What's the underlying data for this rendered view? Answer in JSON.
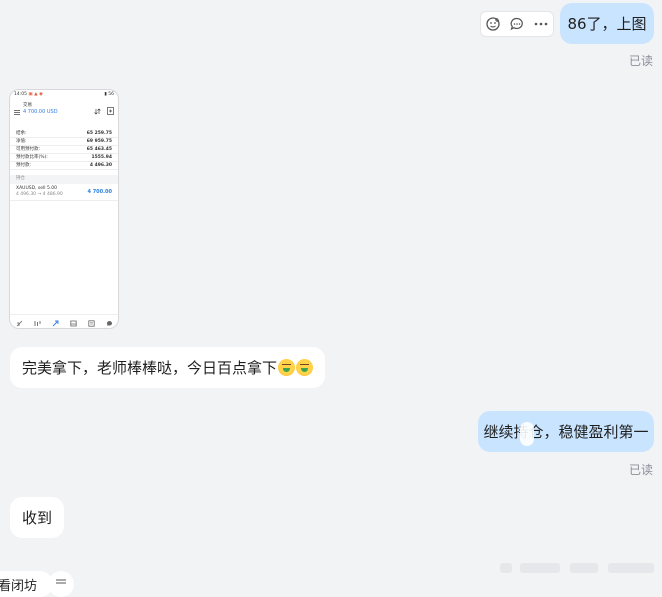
{
  "messages": {
    "m1_text": "86了，上图",
    "m1_status": "已读",
    "m3_text": "完美拿下，老师棒棒哒，今日百点拿下",
    "m4_text": "继续持仓，稳健盈利第一",
    "m4_status": "已读",
    "m5_text": "收到",
    "bottom_tag": "看闭坊"
  },
  "actions": {
    "icons": [
      "emoji-reaction-icon",
      "comment-icon",
      "more-icon"
    ]
  },
  "phone": {
    "status_time": "14:05",
    "status_icons": "▣ ▲ ◉",
    "status_right": "▮ 56",
    "header_title": "交易",
    "header_balance": "4 700.00 USD",
    "rows": [
      {
        "label": "结余:",
        "value": "65 259.75"
      },
      {
        "label": "净值:",
        "value": "69 959.75"
      },
      {
        "label": "可用预付款:",
        "value": "65 463.45"
      },
      {
        "label": "预付款比率(%):",
        "value": "1555.94"
      },
      {
        "label": "预付款:",
        "value": "4 496.30"
      }
    ],
    "section_label": "持仓",
    "position_symbol": "XAUUSD, sell 5.00",
    "position_prices": "4 496.30 → 4 486.90",
    "position_profit": "4 700.00"
  },
  "colors": {
    "bubble_me": "#c9e4ff",
    "bubble_other": "#ffffff",
    "background": "#f2f3f5",
    "profit_blue": "#2f7fe0"
  }
}
